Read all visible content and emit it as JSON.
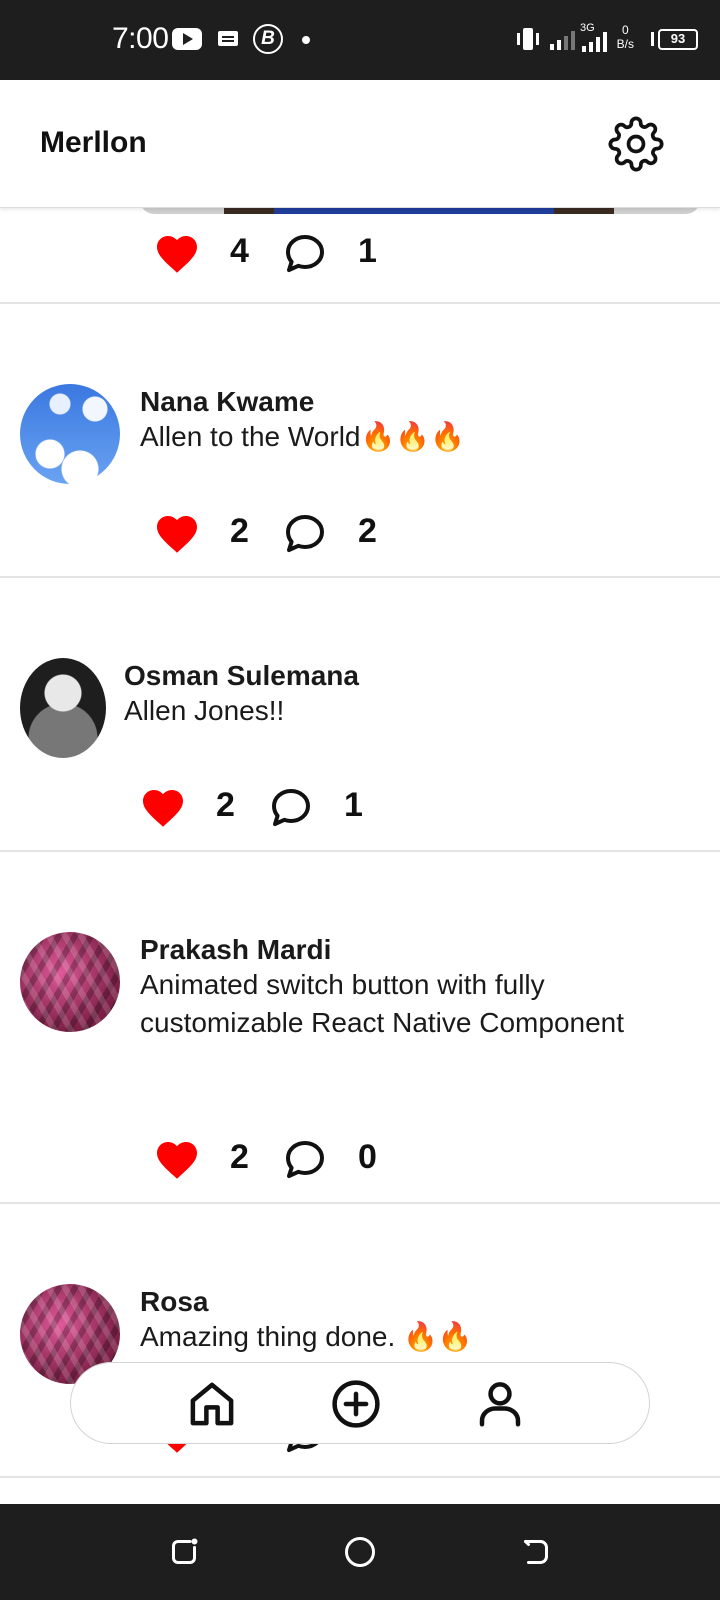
{
  "status_bar": {
    "time": "7:00",
    "network_speed_value": "0",
    "network_speed_unit": "B/s",
    "network_type": "3G",
    "battery": "93"
  },
  "header": {
    "title": "Merllon"
  },
  "previous_post": {
    "likes": "4",
    "comments": "1"
  },
  "posts": [
    {
      "author": "Nana Kwame",
      "text": "Allen to the World🔥🔥🔥",
      "likes": "2",
      "comments": "2"
    },
    {
      "author": "Osman Sulemana",
      "text": "Allen Jones!!",
      "likes": "2",
      "comments": "1"
    },
    {
      "author": "Prakash Mardi",
      "text": "Animated switch button with fully customizable React Native Component",
      "likes": "2",
      "comments": "0"
    },
    {
      "author": "Rosa",
      "text": "Amazing thing done. 🔥🔥",
      "likes": "",
      "comments": ""
    }
  ],
  "colors": {
    "heart": "#ff0000",
    "status_bar_bg": "#1e1e1e",
    "divider": "#e4e4e4"
  },
  "icons": {
    "settings": "gear-icon",
    "like": "heart-icon",
    "comment": "comment-bubble-icon",
    "nav_home": "home-icon",
    "nav_add": "plus-circle-icon",
    "nav_profile": "user-icon"
  }
}
